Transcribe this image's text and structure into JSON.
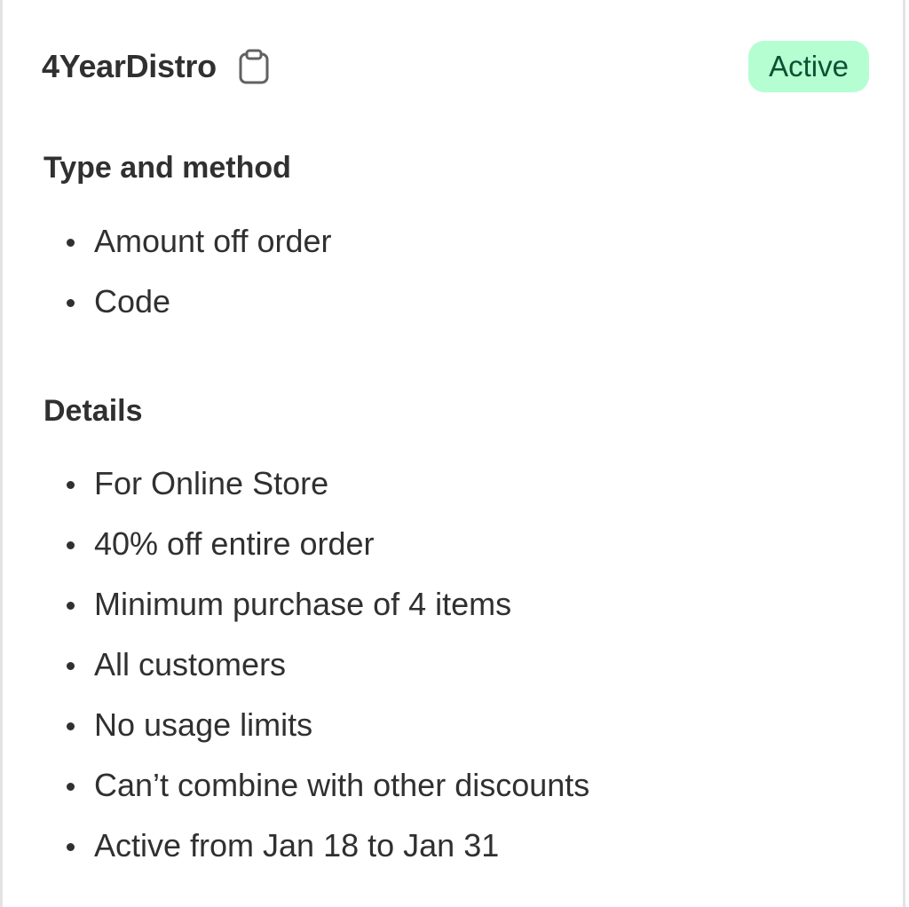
{
  "discount": {
    "name": "4YearDistro",
    "status": "Active",
    "copy_icon": "clipboard-icon"
  },
  "type_and_method": {
    "title": "Type and method",
    "items": [
      "Amount off order",
      "Code"
    ]
  },
  "details": {
    "title": "Details",
    "items": [
      "For Online Store",
      "40% off entire order",
      "Minimum purchase of 4 items",
      "All customers",
      "No usage limits",
      "Can’t combine with other discounts",
      "Active from Jan 18 to Jan 31"
    ]
  },
  "colors": {
    "badge_bg": "#b4fed2",
    "badge_text": "#0c5132",
    "text": "#303030"
  }
}
